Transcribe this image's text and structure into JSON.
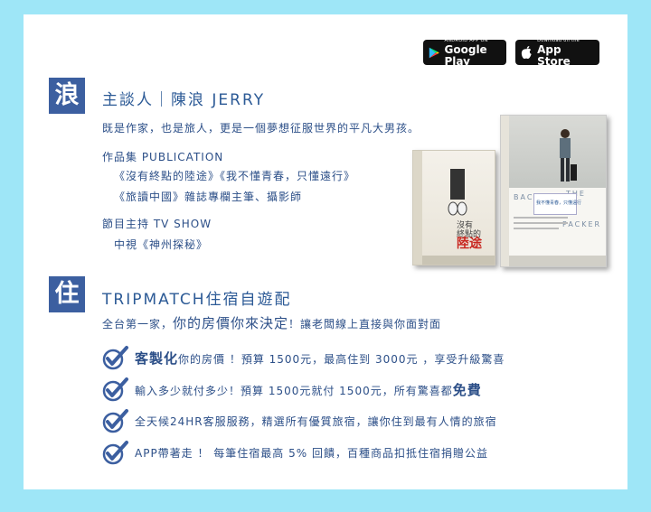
{
  "store_badges": {
    "google_small": "ANDROID APP ON",
    "google_big": "Google Play",
    "apple_small": "Download on the",
    "apple_big": "App Store"
  },
  "host": {
    "icon_char": "浪",
    "title": "主談人｜陳浪 JERRY",
    "intro": "既是作家，也是旅人，更是一個夢想征服世界的平凡大男孩。",
    "publication_heading": "作品集 PUBLICATION",
    "publications": [
      "《沒有終點的陸途》《我不懂青春，只懂遠行》",
      "《旅讀中國》雜誌專欄主筆、攝影師"
    ],
    "show_heading": "節目主持 TV SHOW",
    "show": "中視《神州探秘》"
  },
  "books": {
    "book1_title_a": "沒有",
    "book1_title_b": "終點的",
    "book1_title_c": "陸途",
    "book2_word_a": "BACK",
    "book2_word_b": "THE",
    "book2_word_c": "PACKER",
    "book2_box": "我不懂青春，只懂遠行"
  },
  "tripmatch": {
    "icon_char": "住",
    "title": "TRIPMATCH住宿自遊配",
    "tag_small_a": "全台第一家，",
    "tag_big": "你的房價你來決定",
    "tag_small_b": "！讓老闆線上直接與你面對面",
    "bullets": [
      {
        "pre": "",
        "big": "客製化",
        "post": "你的房價 ！預算 1500元，最高住到 3000元 ，享受升級驚喜"
      },
      {
        "pre": "輸入多少就付多少！預算 1500元就付 1500元，所有驚喜都",
        "big": "免費",
        "post": ""
      },
      {
        "pre": "全天候24HR客服服務，精選所有優質旅宿，讓你住到最有人情的旅宿",
        "big": "",
        "post": ""
      },
      {
        "pre": "APP帶著走 ！ 每筆住宿最高 5% 回饋，百種商品扣抵住宿捐贈公益",
        "big": "",
        "post": ""
      }
    ]
  },
  "colors": {
    "background": "#9ee6f7",
    "icon_box": "#3c5fa0",
    "text": "#2c4f88"
  }
}
